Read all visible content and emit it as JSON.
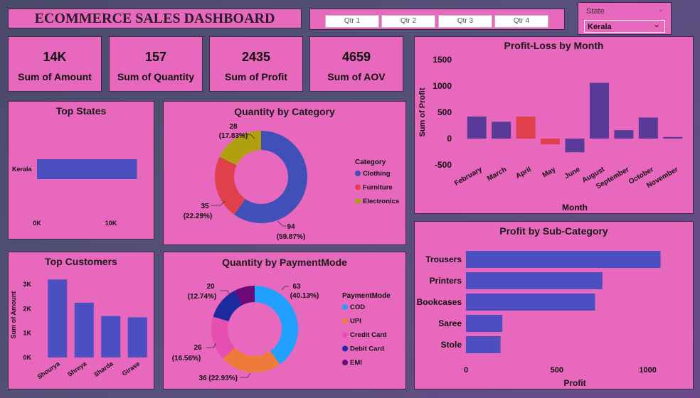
{
  "header": {
    "title": "ECOMMERCE SALES DASHBOARD",
    "quarters": [
      "Qtr 1",
      "Qtr 2",
      "Qtr 3",
      "Qtr 4"
    ],
    "state_label": "State",
    "state_value": "Kerala"
  },
  "kpis": [
    {
      "value": "14K",
      "label": "Sum of Amount"
    },
    {
      "value": "157",
      "label": "Sum of Quantity"
    },
    {
      "value": "2435",
      "label": "Sum of Profit"
    },
    {
      "value": "4659",
      "label": "Sum of AOV"
    }
  ],
  "colors": {
    "panel": "#e868bd",
    "bar_blue": "#4b4fbf",
    "bar_red": "#e0404c"
  },
  "chart_data": [
    {
      "id": "top_states",
      "type": "bar",
      "title": "Top States",
      "orientation": "horizontal",
      "categories": [
        "Kerala"
      ],
      "values": [
        13500
      ],
      "xticks": [
        "0K",
        "10K"
      ],
      "xlim": [
        0,
        15000
      ]
    },
    {
      "id": "top_customers",
      "type": "bar",
      "title": "Top Customers",
      "categories": [
        "Shourya",
        "Shreya",
        "Sharda",
        "Girase"
      ],
      "values": [
        3200,
        2250,
        1700,
        1650
      ],
      "ylabel": "Sum of Amount",
      "yticks": [
        "0K",
        "1K",
        "2K",
        "3K"
      ],
      "ylim": [
        0,
        3500
      ]
    },
    {
      "id": "quantity_by_category",
      "type": "pie",
      "title": "Quantity by Category",
      "legend_title": "Category",
      "slices": [
        {
          "name": "Clothing",
          "value": 94,
          "label": "94",
          "pct": "(59.87%)",
          "color": "#4150b8"
        },
        {
          "name": "Furniture",
          "value": 35,
          "label": "35",
          "pct": "(22.29%)",
          "color": "#e0404c"
        },
        {
          "name": "Electronics",
          "value": 28,
          "label": "28",
          "pct": "(17.83%)",
          "color": "#b0a010"
        }
      ]
    },
    {
      "id": "quantity_by_payment",
      "type": "pie",
      "title": "Quantity by PaymentMode",
      "legend_title": "PaymentMode",
      "slices": [
        {
          "name": "COD",
          "value": 63,
          "label": "63",
          "pct": "(40.13%)",
          "color": "#22a0ff"
        },
        {
          "name": "UPI",
          "value": 36,
          "label": "36",
          "pct": "(22.93%)",
          "color": "#ef7b3a"
        },
        {
          "name": "Credit Card",
          "value": 26,
          "label": "26",
          "pct": "(16.56%)",
          "color": "#e64fb0"
        },
        {
          "name": "Debit Card",
          "value": 20,
          "label": "20",
          "pct": "(12.74%)",
          "color": "#1c2aa0"
        },
        {
          "name": "EMI",
          "value": 12,
          "label": "",
          "pct": "",
          "color": "#6a0a7a"
        }
      ]
    },
    {
      "id": "profit_loss_by_month",
      "type": "bar",
      "title": "Profit-Loss by Month",
      "categories": [
        "February",
        "March",
        "April",
        "May",
        "June",
        "August",
        "September",
        "October",
        "November"
      ],
      "values": [
        420,
        320,
        420,
        -110,
        -260,
        1060,
        160,
        400,
        30
      ],
      "bar_colors": [
        "#5a3a98",
        "#5a3a98",
        "#e0404c",
        "#e0404c",
        "#5a3a98",
        "#5a3a98",
        "#5a3a98",
        "#5a3a98",
        "#5a3a98"
      ],
      "xlabel": "Month",
      "ylabel": "Sum of Profit",
      "yticks": [
        1500,
        1000,
        500,
        0,
        -500
      ],
      "ylim": [
        -500,
        1500
      ]
    },
    {
      "id": "profit_by_subcategory",
      "type": "bar",
      "title": "Profit by Sub-Category",
      "orientation": "horizontal",
      "categories": [
        "Trousers",
        "Printers",
        "Bookcases",
        "Saree",
        "Stole"
      ],
      "values": [
        1070,
        750,
        710,
        200,
        190
      ],
      "xlabel": "Profit",
      "xticks": [
        0,
        500,
        1000
      ],
      "xlim": [
        0,
        1150
      ]
    }
  ]
}
